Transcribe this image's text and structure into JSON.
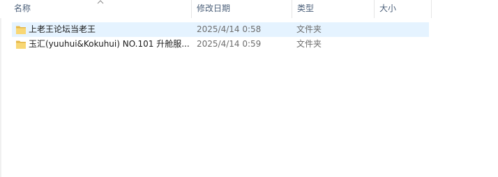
{
  "columns": {
    "name": "名称",
    "modified": "修改日期",
    "type": "类型",
    "size": "大小"
  },
  "rows": [
    {
      "name": "上老王论坛当老王",
      "modified": "2025/4/14 0:58",
      "type": "文件夹",
      "size": "",
      "icon": "folder-icon",
      "selected": true
    },
    {
      "name": "玉汇(yuuhui&Kokuhui) NO.101 升舱服...",
      "modified": "2025/4/14 0:59",
      "type": "文件夹",
      "size": "",
      "icon": "folder-icon",
      "selected": false
    }
  ],
  "colors": {
    "selection": "#e5f3ff",
    "header_text": "#4c607a",
    "folder": "#f8d775"
  }
}
